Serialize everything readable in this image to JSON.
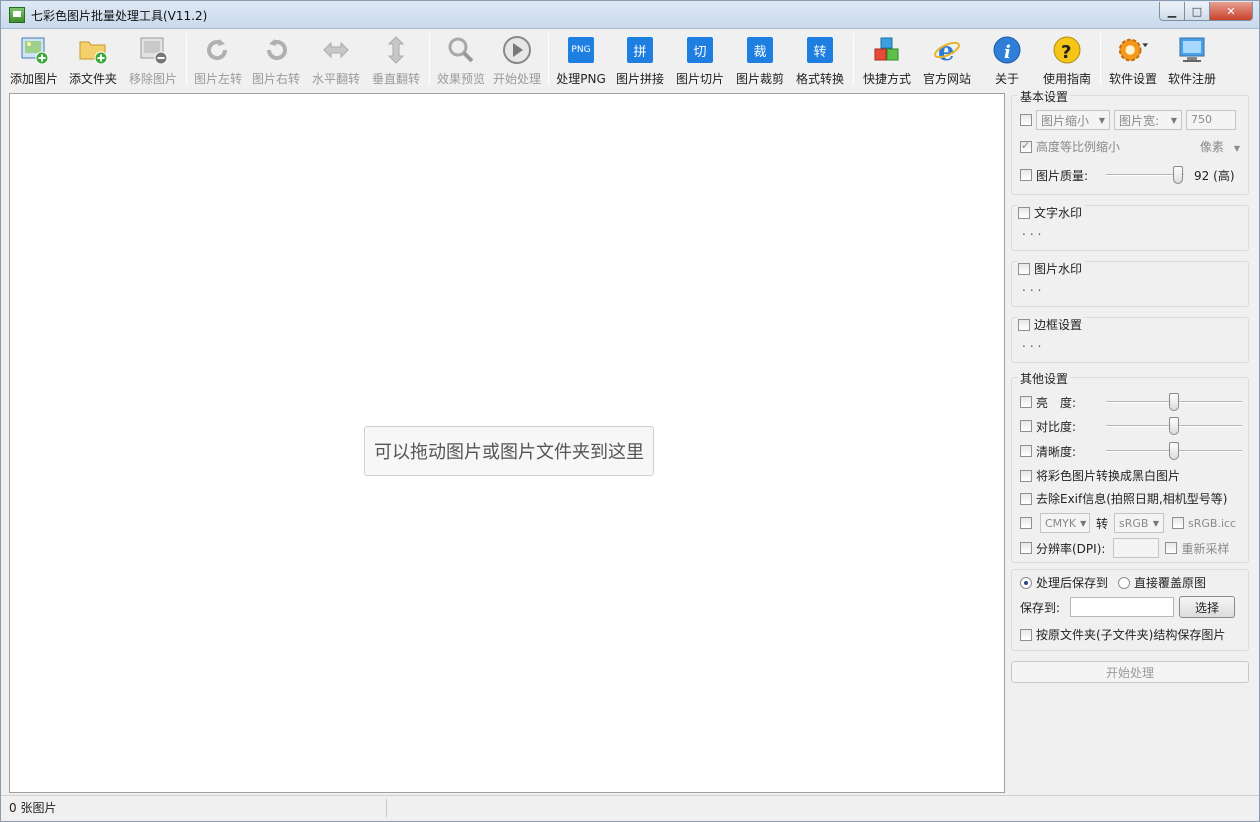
{
  "window": {
    "title": "七彩色图片批量处理工具(V11.2)",
    "minimize": "▁",
    "maximize": "□",
    "close": "✕"
  },
  "toolbar": {
    "add_image": "添加图片",
    "add_folder": "添文件夹",
    "remove_image": "移除图片",
    "rotate_left": "图片左转",
    "rotate_right": "图片右转",
    "flip_h": "水平翻转",
    "flip_v": "垂直翻转",
    "preview": "效果预览",
    "start": "开始处理",
    "process_png": "处理PNG",
    "png_badge": "PNG",
    "stitch": "图片拼接",
    "stitch_badge": "拼",
    "slice": "图片切片",
    "slice_badge": "切",
    "crop": "图片裁剪",
    "crop_badge": "裁",
    "convert": "格式转换",
    "convert_badge": "转",
    "shortcut": "快捷方式",
    "website": "官方网站",
    "about": "关于",
    "guide": "使用指南",
    "settings": "软件设置",
    "register": "软件注册"
  },
  "main": {
    "drop_hint": "可以拖动图片或图片文件夹到这里"
  },
  "basic": {
    "title": "基本设置",
    "resize_mode": "图片缩小",
    "dimension": "图片宽:",
    "width_value": "750",
    "keep_ratio": "高度等比例缩小",
    "unit": "像素",
    "quality_label": "图片质量:",
    "quality_value": "92 (高)",
    "quality_level": 0.92
  },
  "text_watermark": {
    "title": "文字水印",
    "more": "..."
  },
  "image_watermark": {
    "title": "图片水印",
    "more": "..."
  },
  "border": {
    "title": "边框设置",
    "more": "..."
  },
  "other": {
    "title": "其他设置",
    "brightness": "亮　度:",
    "contrast": "对比度:",
    "sharpness": "清晰度:",
    "brightness_level": 0.5,
    "contrast_level": 0.5,
    "sharpness_level": 0.5,
    "grayscale": "将彩色图片转换成黑白图片",
    "remove_exif": "去除Exif信息(拍照日期,相机型号等)",
    "color_from": "CMYK",
    "color_to_label": "转",
    "color_to": "sRGB",
    "icc": "sRGB.icc",
    "dpi": "分辨率(DPI):",
    "resample": "重新采样"
  },
  "save": {
    "save_to_option": "处理后保存到",
    "overwrite_option": "直接覆盖原图",
    "save_to_label": "保存到:",
    "save_path": "",
    "choose": "选择",
    "keep_structure": "按原文件夹(子文件夹)结构保存图片"
  },
  "start_button": "开始处理",
  "status": {
    "count": "0 张图片"
  }
}
